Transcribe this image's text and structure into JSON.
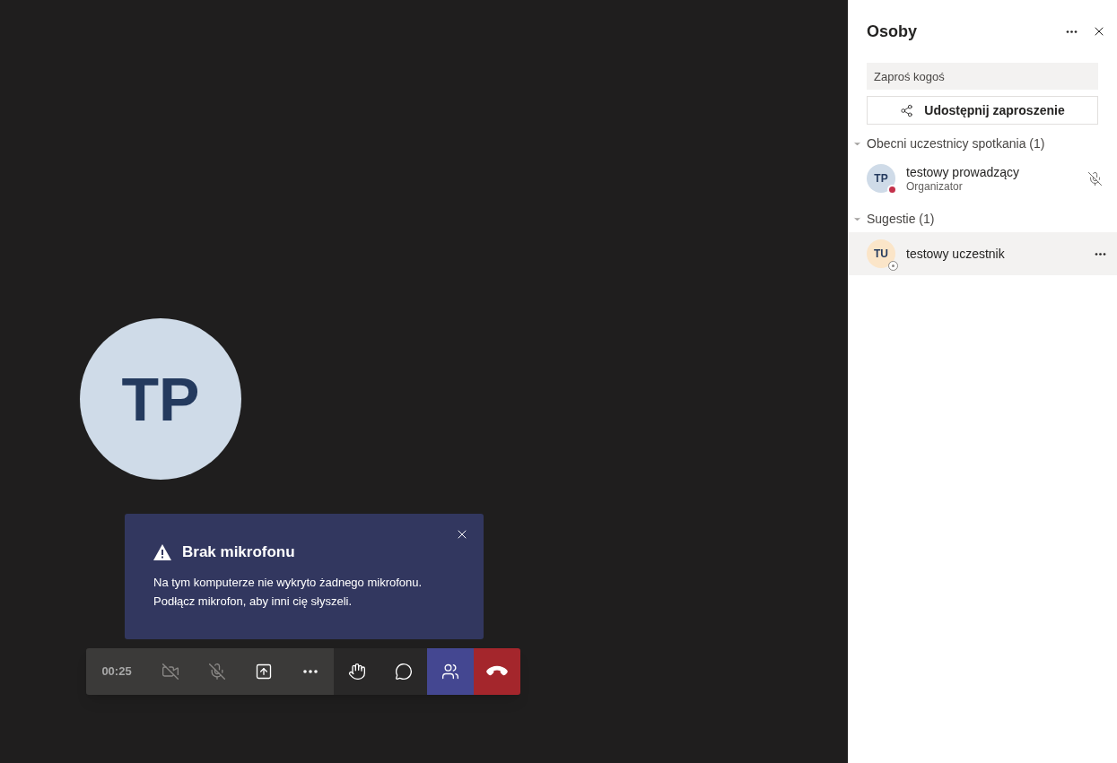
{
  "stage": {
    "avatar_initials": "TP"
  },
  "toast": {
    "title": "Brak mikrofonu",
    "message": "Na tym komputerze nie wykryto żadnego mikrofonu.\nPodłącz mikrofon, aby inni cię słyszeli."
  },
  "toolbar": [
    {
      "kind": "timer",
      "label": "00:25"
    },
    {
      "kind": "camera",
      "disabled": true,
      "selected": false
    },
    {
      "kind": "mic",
      "disabled": true,
      "selected": false
    },
    {
      "kind": "share",
      "disabled": false,
      "selected": false
    },
    {
      "kind": "more",
      "disabled": false,
      "selected": false
    },
    {
      "kind": "hand",
      "disabled": false,
      "selected": false
    },
    {
      "kind": "chat",
      "disabled": false,
      "selected": false
    },
    {
      "kind": "people",
      "disabled": false,
      "selected": true
    },
    {
      "kind": "hangup",
      "disabled": false
    }
  ],
  "panel": {
    "title": "Osoby",
    "invite_placeholder": "Zaproś kogoś",
    "share_button": "Udostępnij zaproszenie",
    "sections": [
      {
        "label": "Obecni uczestnicy spotkania (1)",
        "expanded": true,
        "people": [
          {
            "initials": "TP",
            "name": "testowy prowadzący",
            "role": "Organizator",
            "color": "#cfdbe8",
            "busy": true,
            "muted": true,
            "selected": false
          }
        ]
      },
      {
        "label": "Sugestie (1)",
        "expanded": true,
        "people": [
          {
            "initials": "TU",
            "name": "testowy uczestnik",
            "color": "#fbe5c8",
            "busy": false,
            "muted": false,
            "selected": true
          }
        ]
      }
    ]
  }
}
